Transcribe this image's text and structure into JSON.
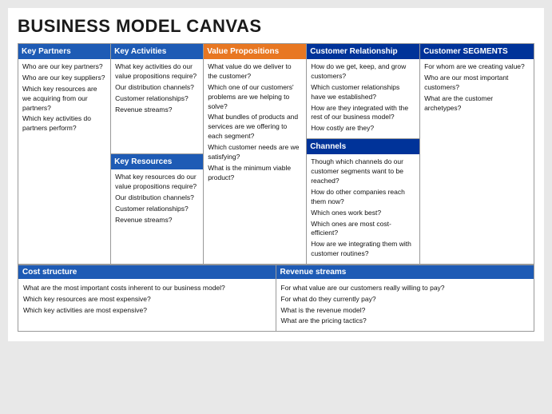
{
  "title": "BUSINESS MODEL CANVAS",
  "sections": {
    "key_partners": {
      "header": "Key Partners",
      "body": [
        "Who are our key partners?",
        "Who are our key suppliers?",
        "Which key resources are we acquiring from our partners?",
        "Which key activities do partners perform?"
      ]
    },
    "key_activities": {
      "header": "Key Activities",
      "body": [
        "What key activities do our value propositions require?",
        "Our distribution channels?",
        "Customer relationships?",
        "Revenue streams?"
      ]
    },
    "key_resources": {
      "header": "Key Resources",
      "body": [
        "What key resources do our value propositions require?",
        "Our distribution channels?",
        "Customer relationships?",
        "Revenue streams?"
      ]
    },
    "value_propositions": {
      "header": "Value Propositions",
      "body": [
        "What value do we deliver to the customer?",
        "Which one of our customers' problems are we helping to solve?",
        "What bundles of products and services are we offering to each segment?",
        "Which customer needs are we satisfying?",
        "What is the minimum viable product?"
      ]
    },
    "customer_relationship": {
      "header": "Customer Relationship",
      "body": [
        "How do we get, keep, and grow customers?",
        "Which customer relationships have we established?",
        "How are they integrated with the rest of our business model?",
        "How costly are they?"
      ]
    },
    "channels": {
      "header": "Channels",
      "body": [
        "Though which channels do our customer segments want to be reached?",
        "How do other companies reach them now?",
        "Which ones work best?",
        "Which ones are most cost-efficient?",
        "How are we integrating them with customer routines?"
      ]
    },
    "customer_segments": {
      "header": "Customer SEGMENTS",
      "body": [
        "For whom are we creating value?",
        "Who are our most important customers?",
        "What are the customer archetypes?"
      ]
    },
    "cost_structure": {
      "header": "Cost structure",
      "body": [
        "What are the most important costs inherent to our business model?",
        "Which key resources are most expensive?",
        "Which key activities are most expensive?"
      ]
    },
    "revenue_streams": {
      "header": "Revenue streams",
      "body": [
        "For what value are our customers really willing to pay?",
        "For what do they currently pay?",
        "What is the revenue model?",
        "What are the pricing tactics?"
      ]
    }
  }
}
